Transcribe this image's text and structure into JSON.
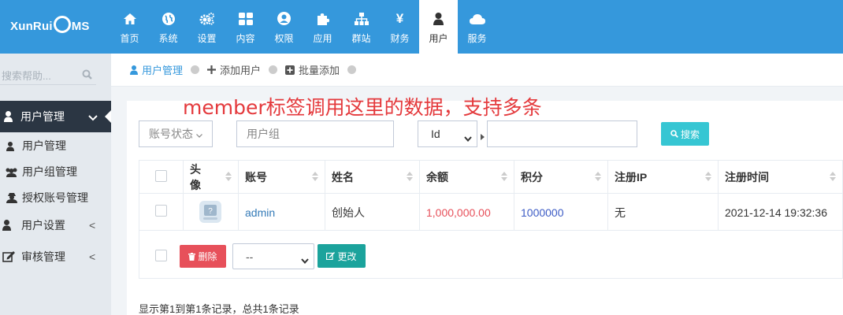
{
  "logo": {
    "text_left": "XunRui",
    "text_right": "MS"
  },
  "nav": [
    {
      "label": "首页",
      "icon": "home-icon"
    },
    {
      "label": "系统",
      "icon": "globe-icon"
    },
    {
      "label": "设置",
      "icon": "gears-icon"
    },
    {
      "label": "内容",
      "icon": "grid-icon"
    },
    {
      "label": "权限",
      "icon": "user-circle-icon"
    },
    {
      "label": "应用",
      "icon": "puzzle-icon"
    },
    {
      "label": "群站",
      "icon": "sitemap-icon"
    },
    {
      "label": "财务",
      "icon": "yen-icon"
    },
    {
      "label": "用户",
      "icon": "user-icon",
      "active": true
    },
    {
      "label": "服务",
      "icon": "cloud-icon"
    }
  ],
  "nav_yen_glyph": "¥",
  "sidebar": {
    "search_placeholder": "搜索帮助...",
    "active_menu": "用户管理",
    "sub_items": [
      "用户管理",
      "用户组管理",
      "授权账号管理"
    ],
    "groups": [
      "用户设置",
      "审核管理"
    ],
    "group_arrow": "<"
  },
  "breadcrumb": [
    "用户管理",
    "添加用户",
    "批量添加"
  ],
  "annotation": "member标签调用这里的数据，支持多条",
  "filters": {
    "status": "账号状态",
    "group": "用户组",
    "field": "Id",
    "search_button": "搜索"
  },
  "table": {
    "headers": [
      "头像",
      "账号",
      "姓名",
      "余额",
      "积分",
      "注册IP",
      "注册时间"
    ],
    "rows": [
      {
        "account": "admin",
        "name": "创始人",
        "balance": "1,000,000.00",
        "points": "1000000",
        "ip": "无",
        "time": "2021-12-14 19:32:36"
      }
    ]
  },
  "actions": {
    "delete": "删除",
    "select": "--",
    "edit": "更改"
  },
  "footer": "显示第1到第1条记录，总共1条记录",
  "colors": {
    "topbar": "#3598dc",
    "sidebar_active": "#2b3643",
    "search_btn": "#36c6d3",
    "delete_btn": "#e7505a",
    "edit_btn": "#1ba39c",
    "balance": "#e7505a",
    "link": "#337ab7",
    "points": "#3d5cc5",
    "annotation": "#e4393c"
  }
}
